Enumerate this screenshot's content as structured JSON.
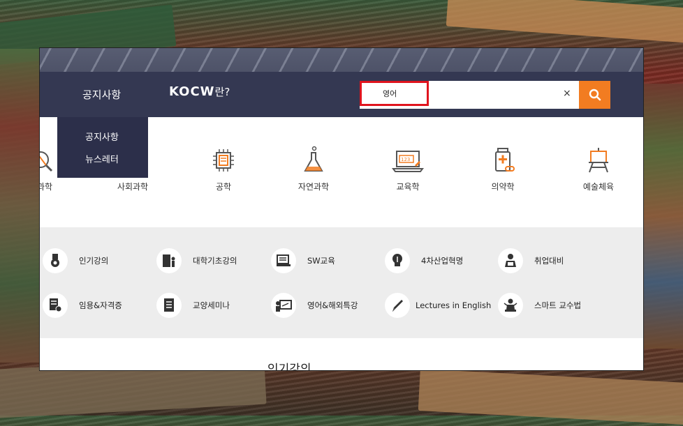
{
  "nav": {
    "notice": "공지사항",
    "logo_brand": "KOCW",
    "logo_suffix": "란?"
  },
  "search": {
    "value": "영어",
    "clear": "×"
  },
  "dropdown": {
    "items": [
      "공지사항",
      "뉴스레터"
    ]
  },
  "categories": [
    {
      "label": "공학과학",
      "icon": "reading-icon"
    },
    {
      "label": "사회과학",
      "icon": "scale-icon"
    },
    {
      "label": "공학",
      "icon": "chip-icon"
    },
    {
      "label": "자연과학",
      "icon": "flask-icon"
    },
    {
      "label": "교육학",
      "icon": "laptop-icon"
    },
    {
      "label": "의약학",
      "icon": "medicine-icon"
    },
    {
      "label": "예술체육",
      "icon": "easel-icon"
    }
  ],
  "categories_visible": [
    "과학",
    "사회과학",
    "공학",
    "자연과학",
    "교육학",
    "의약학",
    "예술체육"
  ],
  "tiles": [
    {
      "label": "인기강의",
      "icon": "medal-icon"
    },
    {
      "label": "대학기초강의",
      "icon": "book-person-icon"
    },
    {
      "label": "SW교육",
      "icon": "monitor-icon"
    },
    {
      "label": "4차산업혁명",
      "icon": "lightbulb-icon"
    },
    {
      "label": "취업대비",
      "icon": "person-laptop-icon"
    },
    {
      "label": "임용&자격증",
      "icon": "certificate-icon"
    },
    {
      "label": "교양세미나",
      "icon": "notebook-icon"
    },
    {
      "label": "영어&해외특강",
      "icon": "chalkboard-icon"
    },
    {
      "label": "Lectures in English",
      "icon": "pen-icon"
    },
    {
      "label": "스마트 교수법",
      "icon": "lecturer-icon"
    }
  ],
  "popular": {
    "title": "인기강의"
  },
  "colors": {
    "header": "#343852",
    "accent": "#f27c21",
    "highlight": "#e0141e",
    "dropdown": "#2c2f4a",
    "panel": "#ededed"
  }
}
